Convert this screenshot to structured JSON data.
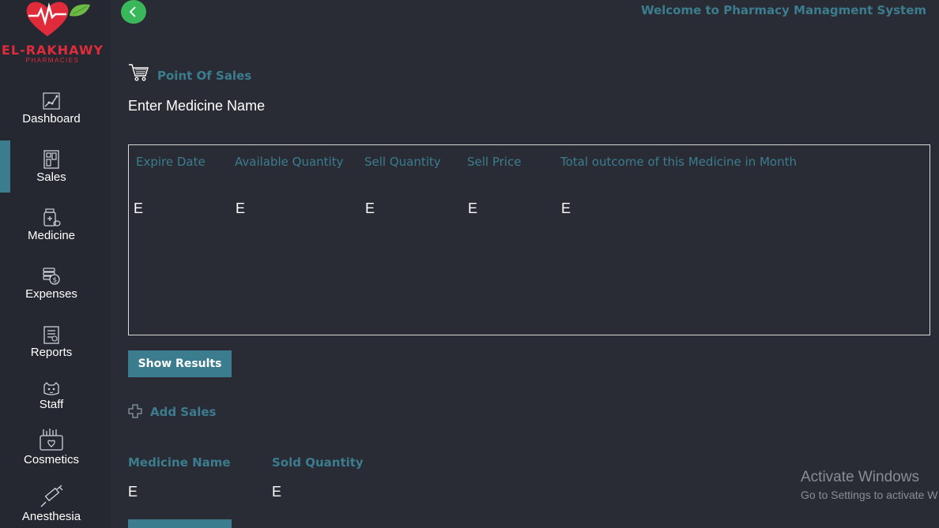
{
  "brand": {
    "name": "EL-RAKHAWY",
    "subtitle": "PHARMACIES"
  },
  "sidebar": {
    "items": [
      {
        "label": "Dashboard",
        "icon": "chart-line-icon"
      },
      {
        "label": "Sales",
        "icon": "register-icon",
        "active": true
      },
      {
        "label": "Medicine",
        "icon": "medicine-bottle-icon"
      },
      {
        "label": "Expenses",
        "icon": "coins-icon"
      },
      {
        "label": "Reports",
        "icon": "report-clipboard-icon"
      },
      {
        "label": "Staff",
        "icon": "staff-face-icon"
      },
      {
        "label": "Cosmetics",
        "icon": "cosmetics-bag-icon"
      },
      {
        "label": "Anesthesia",
        "icon": "syringe-icon"
      }
    ]
  },
  "header": {
    "welcome": "Welcome to Pharmacy Managment System",
    "back_icon": "chevron-left-icon"
  },
  "pos": {
    "title": "Point Of Sales",
    "icon": "cart-icon",
    "medicine_input_placeholder": "Enter Medicine Name",
    "columns": [
      "Expire Date",
      "Available Quantity",
      "Sell Quantity",
      "Sell Price",
      "Total outcome of this Medicine in Month"
    ],
    "values": [
      "E",
      "E",
      "E",
      "E",
      "E"
    ],
    "show_results_label": "Show Results"
  },
  "add_sales": {
    "label": "Add Sales",
    "icon": "plus-icon",
    "columns": [
      "Medicine Name",
      "Sold Quantity"
    ],
    "values": [
      "E",
      "E"
    ]
  },
  "watermark": {
    "line1": "Activate Windows",
    "line2": "Go to Settings to activate W"
  },
  "colors": {
    "background": "#292c35",
    "sidebar": "#252831",
    "accent": "#3b7d8e",
    "back_button": "#3ab65b",
    "brand_red": "#e02b3a"
  }
}
